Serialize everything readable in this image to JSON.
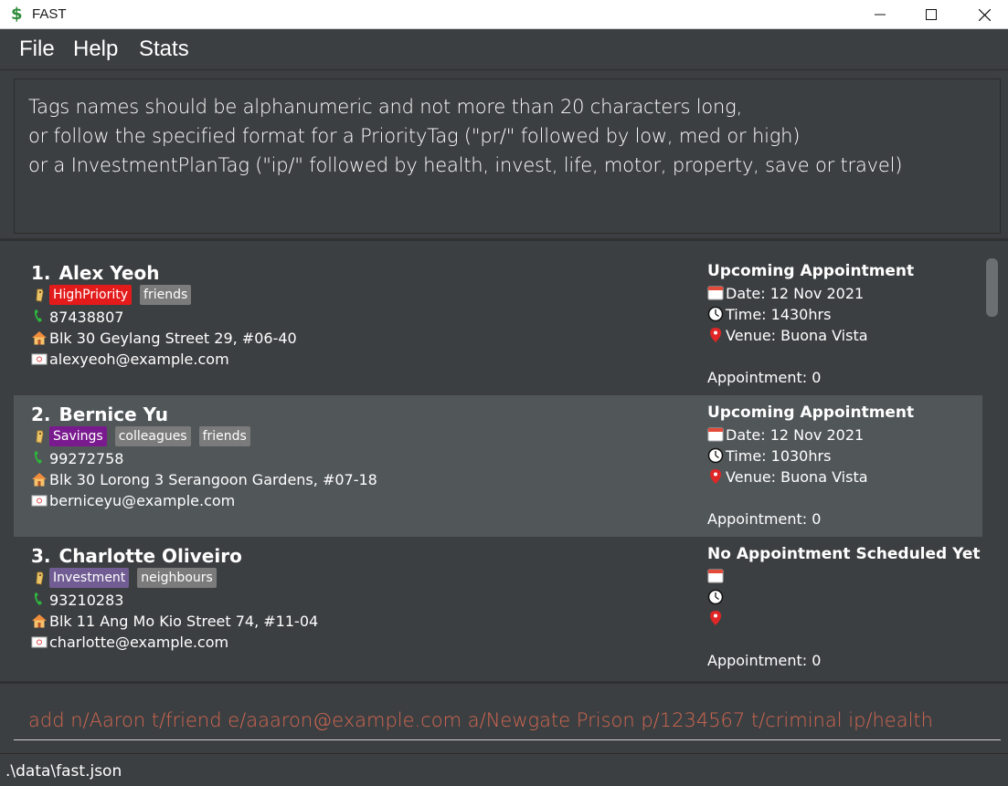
{
  "window": {
    "title": "FAST"
  },
  "menu": {
    "file": "File",
    "help": "Help",
    "stats": "Stats"
  },
  "result": {
    "lines": [
      "Tags names should be alphanumeric and not more than 20 characters long,",
      "or follow the specified format for a PriorityTag (\"pr/\" followed by low, med or high)",
      "or a InvestmentPlanTag (\"ip/\" followed by health, invest, life, motor, property, save or travel)"
    ]
  },
  "persons": [
    {
      "index": "1.",
      "name": "Alex Yeoh",
      "tags": [
        {
          "label": "HighPriority",
          "color": "#e31b1b"
        },
        {
          "label": "friends",
          "color": "#7b7b7b"
        }
      ],
      "phone": "87438807",
      "address": "Blk 30 Geylang Street 29, #06-40",
      "email": "alexyeoh@example.com",
      "appointment": {
        "title": "Upcoming Appointment",
        "date": "Date: 12 Nov 2021",
        "time": "Time: 1430hrs",
        "venue": "Venue: Buona Vista",
        "count": "Appointment: 0"
      }
    },
    {
      "index": "2.",
      "name": "Bernice Yu",
      "tags": [
        {
          "label": "Savings",
          "color": "#7a1a8f"
        },
        {
          "label": "colleagues",
          "color": "#7b7b7b"
        },
        {
          "label": "friends",
          "color": "#7b7b7b"
        }
      ],
      "phone": "99272758",
      "address": "Blk 30 Lorong 3 Serangoon Gardens, #07-18",
      "email": "berniceyu@example.com",
      "appointment": {
        "title": "Upcoming Appointment",
        "date": "Date: 12 Nov 2021",
        "time": "Time: 1030hrs",
        "venue": "Venue: Buona Vista",
        "count": "Appointment: 0"
      }
    },
    {
      "index": "3.",
      "name": "Charlotte Oliveiro",
      "tags": [
        {
          "label": "Investment",
          "color": "#715d93"
        },
        {
          "label": "neighbours",
          "color": "#7b7b7b"
        }
      ],
      "phone": "93210283",
      "address": "Blk 11 Ang Mo Kio Street 74, #11-04",
      "email": "charlotte@example.com",
      "appointment": {
        "title": "No Appointment Scheduled Yet",
        "date": "",
        "time": "",
        "venue": "",
        "count": "Appointment: 0"
      }
    }
  ],
  "command": {
    "value": "add n/Aaron t/friend e/aaaron@example.com a/Newgate Prison p/1234567 t/criminal ip/health"
  },
  "status": {
    "path": ".\\data\\fast.json"
  },
  "colors": {
    "background": "#3c3f41",
    "alt_row": "#515658",
    "command_text": "#d06651"
  },
  "icons": [
    "dollar-icon",
    "minimize-icon",
    "maximize-icon",
    "close-icon",
    "tag-icon",
    "phone-icon",
    "home-icon",
    "email-icon",
    "calendar-icon",
    "clock-icon",
    "location-pin-icon"
  ]
}
